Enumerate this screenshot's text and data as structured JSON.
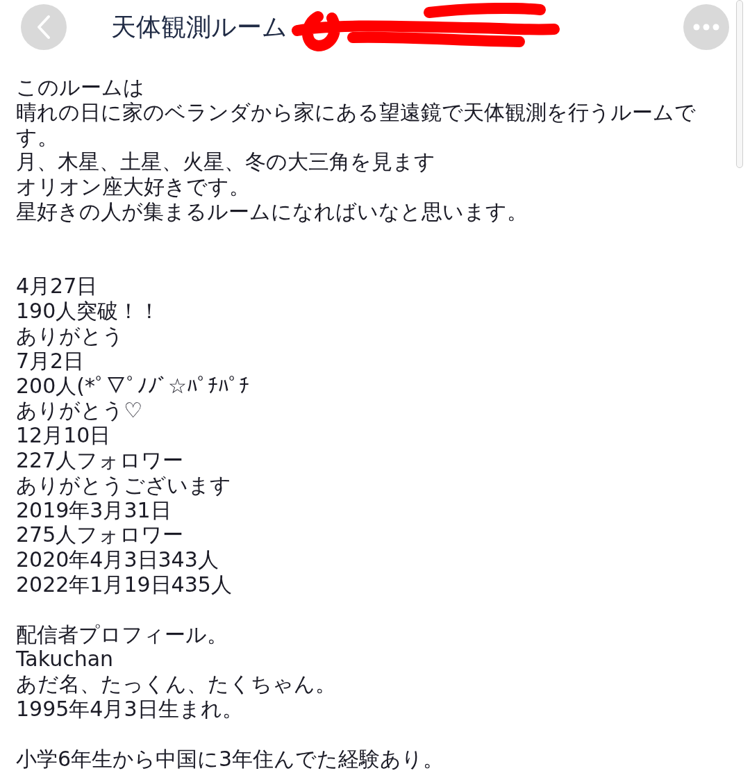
{
  "header": {
    "title": "天体観測ルーム"
  },
  "paragraphs": [
    {
      "lines": [
        "このルームは",
        "晴れの日に家のベランダから家にある望遠鏡で天体観測を行うルームです。",
        "月、木星、土星、火星、冬の大三角を見ます",
        "オリオン座大好きです。",
        "星好きの人が集まるルームになればいなと思います。"
      ]
    },
    {
      "lines": [
        "4月27日",
        "190人突破！！",
        "ありがとう",
        "7月2日",
        "200人(*ﾟ▽ﾟﾉﾉﾞ☆ﾊﾟﾁﾊﾟﾁ",
        "ありがとう♡",
        "12月10日",
        "227人フォロワー",
        "ありがとうございます",
        "2019年3月31日",
        "275人フォロワー",
        "2020年4月3日343人",
        "2022年1月19日435人"
      ]
    },
    {
      "lines": [
        "配信者プロフィール。",
        "Takuchan",
        "あだ名、たっくん、たくちゃん。",
        "1995年4月3日生まれ。"
      ]
    },
    {
      "lines": [
        "小学6年生から中国に3年住んでた経験あり。"
      ]
    }
  ]
}
